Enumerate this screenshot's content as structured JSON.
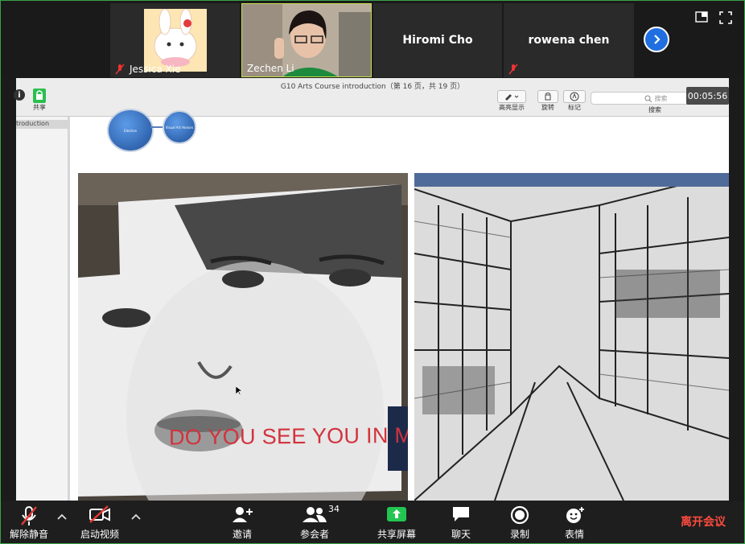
{
  "participants": [
    {
      "name": "Jessica Xie",
      "muted": true
    },
    {
      "name": "Zechen Li",
      "muted": false
    },
    {
      "name": "Hiromi Cho",
      "muted": false
    },
    {
      "name": "rowena chen",
      "muted": true
    }
  ],
  "viewer": {
    "doc_title": "G10  Arts Course introduction（第 16 页，共 19 页）",
    "share_label": "共享",
    "highlight_label": "高亮显示",
    "rotate_label": "旋转",
    "mark_label": "标记",
    "search_label": "搜索",
    "search_placeholder": "搜索",
    "sidebar_item": "troduction",
    "timer": "00:05:56"
  },
  "slide": {
    "bubble_elective": "Elective",
    "bubble_visual_art": "Visual Art Honors",
    "portrait_caption": "DO YOU SEE YOU IN ME?"
  },
  "controls": {
    "unmute": "解除静音",
    "start_video": "启动视频",
    "invite": "邀请",
    "participants": "参会者",
    "participant_count": "34",
    "share_screen": "共享屏幕",
    "chat": "聊天",
    "record": "录制",
    "reactions": "表情",
    "leave": "离开会议"
  },
  "colors": {
    "accent_blue": "#1f6fe0",
    "share_green": "#23c552",
    "leave_red": "#ff4b3e",
    "active_border": "#c8e04a"
  }
}
